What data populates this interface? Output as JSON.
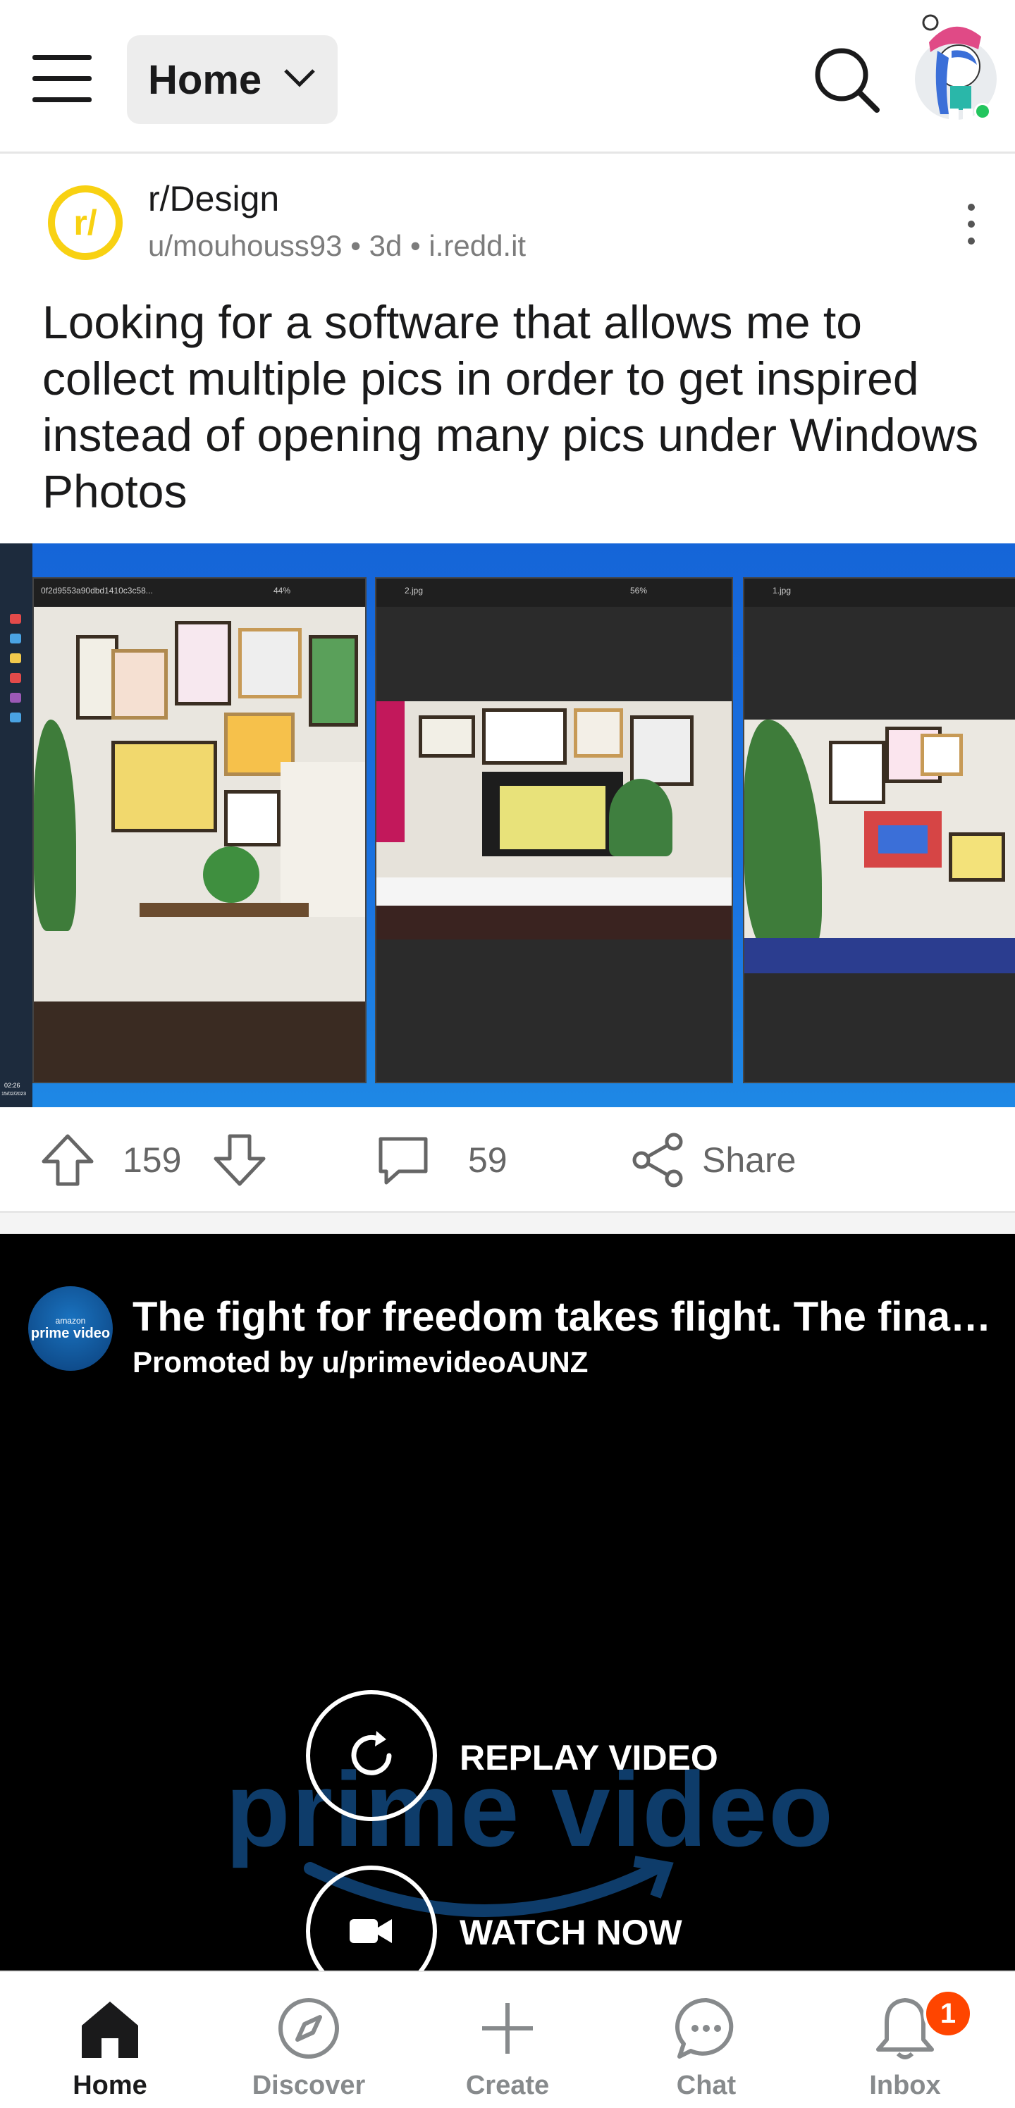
{
  "header": {
    "feed_selector_label": "Home"
  },
  "post": {
    "subreddit": "r/Design",
    "subreddit_icon_text": "r/",
    "author": "u/mouhouss93",
    "age": "3d",
    "domain": "i.redd.it",
    "meta_separator": "•",
    "title": "Looking for a software that allows me to collect multiple pics in order to get inspired instead of opening many pics under Windows Photos",
    "image_windows": [
      {
        "filename": "0f2d9553a90dbd1410c3c58...",
        "zoom": "44%"
      },
      {
        "filename": "2.jpg",
        "zoom": "56%"
      },
      {
        "filename": "1.jpg",
        "zoom": ""
      }
    ],
    "taskbar_clock": {
      "time": "02:26",
      "date": "15/02/2023"
    },
    "actions": {
      "upvotes": "159",
      "comments": "59",
      "share_label": "Share"
    }
  },
  "promo": {
    "avatar_line1": "amazon",
    "avatar_line2": "prime video",
    "title": "The fight for freedom takes flight. The final season of The Marvelous",
    "promoted_by": "Promoted by u/primevideoAUNZ",
    "background_logo": "prime video",
    "replay_label": "REPLAY VIDEO",
    "watch_label": "WATCH NOW"
  },
  "bottom_nav": {
    "items": [
      {
        "label": "Home",
        "icon": "home-icon",
        "active": true
      },
      {
        "label": "Discover",
        "icon": "compass-icon",
        "active": false
      },
      {
        "label": "Create",
        "icon": "plus-icon",
        "active": false
      },
      {
        "label": "Chat",
        "icon": "chat-icon",
        "active": false
      },
      {
        "label": "Inbox",
        "icon": "bell-icon",
        "active": false
      }
    ],
    "inbox_badge": "1"
  },
  "colors": {
    "accent_orange": "#ff4500",
    "subreddit_icon": "#f8d112",
    "online_dot": "#23c55e"
  }
}
